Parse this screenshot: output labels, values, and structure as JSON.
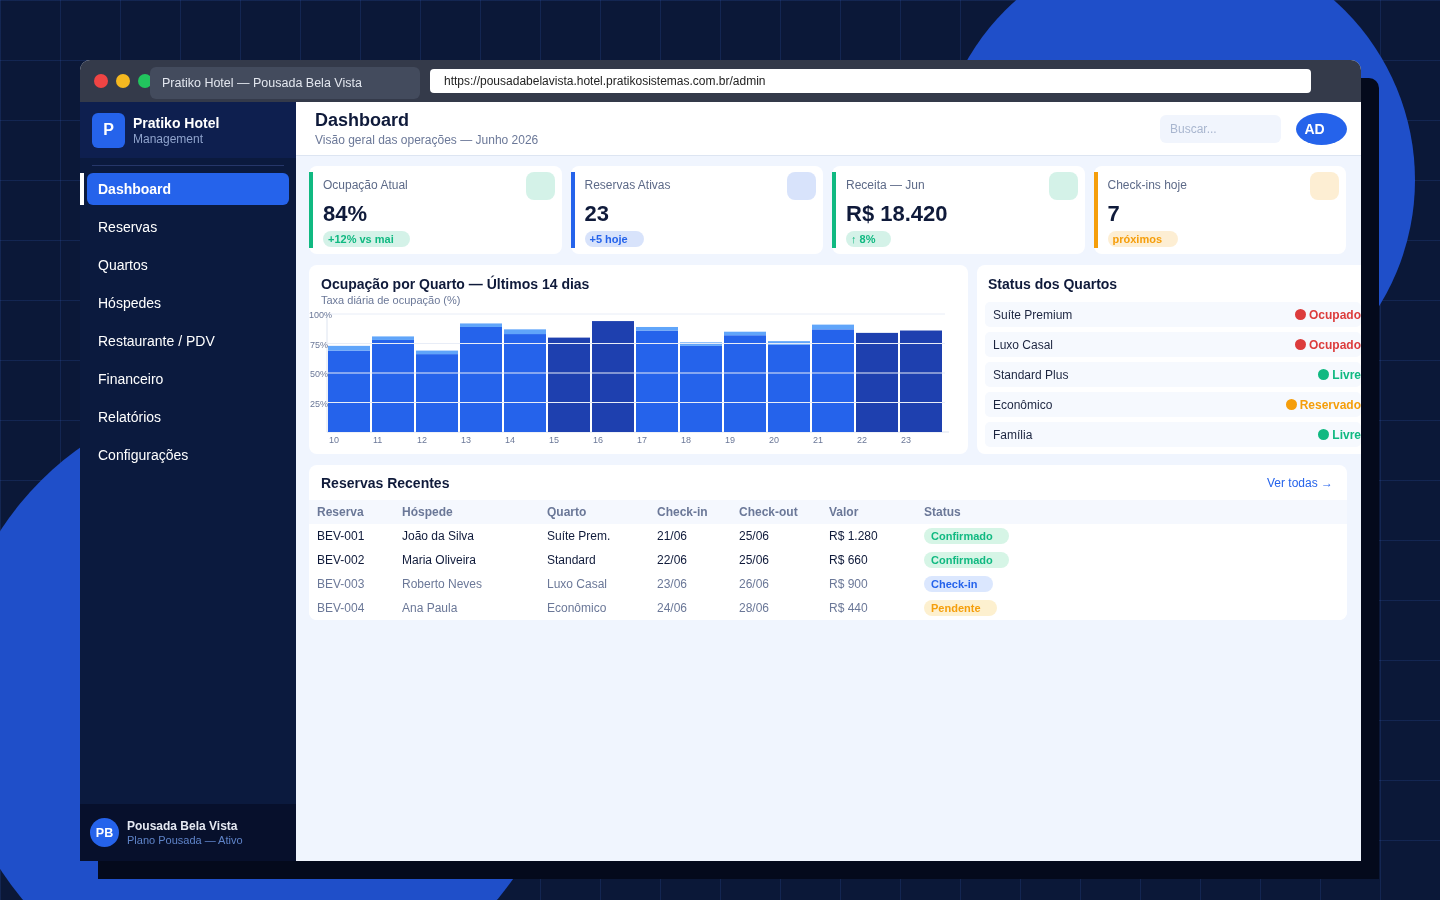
{
  "browser": {
    "tab_title": "Pratiko Hotel — Pousada Bela Vista",
    "url": "https://pousadabelavista.hotel.pratikosistemas.com.br/admin"
  },
  "sidebar": {
    "logo_letter": "P",
    "brand": "Pratiko Hotel",
    "tagline": "Management",
    "items": [
      {
        "label": "Dashboard",
        "selected": true
      },
      {
        "label": "Reservas",
        "selected": false
      },
      {
        "label": "Quartos",
        "selected": false
      },
      {
        "label": "Hóspedes",
        "selected": false
      },
      {
        "label": "Restaurante / PDV",
        "selected": false
      },
      {
        "label": "Financeiro",
        "selected": false
      },
      {
        "label": "Relatórios",
        "selected": false
      },
      {
        "label": "Configurações",
        "selected": false
      }
    ],
    "account": {
      "initials": "PB",
      "name": "Pousada Bela Vista",
      "plan": "Plano Pousada — Ativo"
    }
  },
  "header": {
    "title": "Dashboard",
    "subtitle": "Visão geral das operações — Junho 2026",
    "search_placeholder": "Buscar...",
    "avatar": "AD"
  },
  "stats": [
    {
      "label": "Ocupação Atual",
      "value": "84%",
      "badge": "+12% vs mai",
      "color": "#10b981"
    },
    {
      "label": "Reservas Ativas",
      "value": "23",
      "badge": "+5 hoje",
      "color": "#2563eb"
    },
    {
      "label": "Receita — Jun",
      "value": "R$ 18.420",
      "badge": "↑ 8%",
      "color": "#10b981"
    },
    {
      "label": "Check-ins hoje",
      "value": "7",
      "badge": "próximos",
      "color": "#f59e0b"
    }
  ],
  "occupancy": {
    "title": "Ocupação por Quarto — Últimos 14 dias",
    "subtitle": "Taxa diária de ocupação (%)",
    "chart_data": {
      "type": "bar",
      "stacked": true,
      "grid": true,
      "categories": [
        "10",
        "11",
        "12",
        "13",
        "14",
        "15",
        "16",
        "17",
        "18",
        "19",
        "20",
        "21",
        "22",
        "23"
      ],
      "ylim": [
        0,
        100
      ],
      "yticks": [
        {
          "value": 25,
          "label": "25%"
        },
        {
          "value": 50,
          "label": "50%"
        },
        {
          "value": 75,
          "label": "75%"
        },
        {
          "value": 100,
          "label": "100%"
        }
      ],
      "series": [
        {
          "color": "#2563eb",
          "values": [
            69,
            78,
            66,
            89,
            83,
            null,
            null,
            86,
            73,
            82,
            74,
            87,
            null,
            null
          ]
        },
        {
          "color": "#1e40af",
          "values": [
            null,
            null,
            null,
            null,
            null,
            80,
            94,
            null,
            null,
            null,
            null,
            null,
            84,
            86
          ]
        },
        {
          "color": "#60a5fa",
          "values": [
            4,
            3,
            3,
            3,
            4,
            null,
            null,
            3,
            3,
            3,
            3,
            4,
            null,
            null
          ]
        }
      ]
    }
  },
  "room_status": {
    "title": "Status dos Quartos",
    "rooms": [
      {
        "name": "Suíte Premium",
        "status": "Ocupado",
        "color": "#dc3c3c"
      },
      {
        "name": "Luxo Casal",
        "status": "Ocupado",
        "color": "#dc3c3c"
      },
      {
        "name": "Standard Plus",
        "status": "Livre",
        "color": "#10b981"
      },
      {
        "name": "Econômico",
        "status": "Reservado",
        "color": "#f59e0b"
      },
      {
        "name": "Família",
        "status": "Livre",
        "color": "#10b981"
      }
    ]
  },
  "recent": {
    "title": "Reservas Recentes",
    "link": "Ver todas →",
    "columns": [
      "Reserva",
      "Hóspede",
      "Quarto",
      "Check-in",
      "Check-out",
      "Valor",
      "Status"
    ],
    "rows": [
      {
        "cells": [
          "BEV-001",
          "João da Silva",
          "Suíte Prem.",
          "21/06",
          "25/06",
          "R$ 1.280"
        ],
        "status": "Confirmado",
        "kind": "confirmed",
        "dimmed": false
      },
      {
        "cells": [
          "BEV-002",
          "Maria Oliveira",
          "Standard",
          "22/06",
          "25/06",
          "R$ 660"
        ],
        "status": "Confirmado",
        "kind": "confirmed",
        "dimmed": false
      },
      {
        "cells": [
          "BEV-003",
          "Roberto Neves",
          "Luxo Casal",
          "23/06",
          "26/06",
          "R$ 900"
        ],
        "status": "Check-in",
        "kind": "checkin",
        "dimmed": true
      },
      {
        "cells": [
          "BEV-004",
          "Ana Paula",
          "Econômico",
          "24/06",
          "28/06",
          "R$ 440"
        ],
        "status": "Pendente",
        "kind": "pending",
        "dimmed": true
      }
    ]
  }
}
